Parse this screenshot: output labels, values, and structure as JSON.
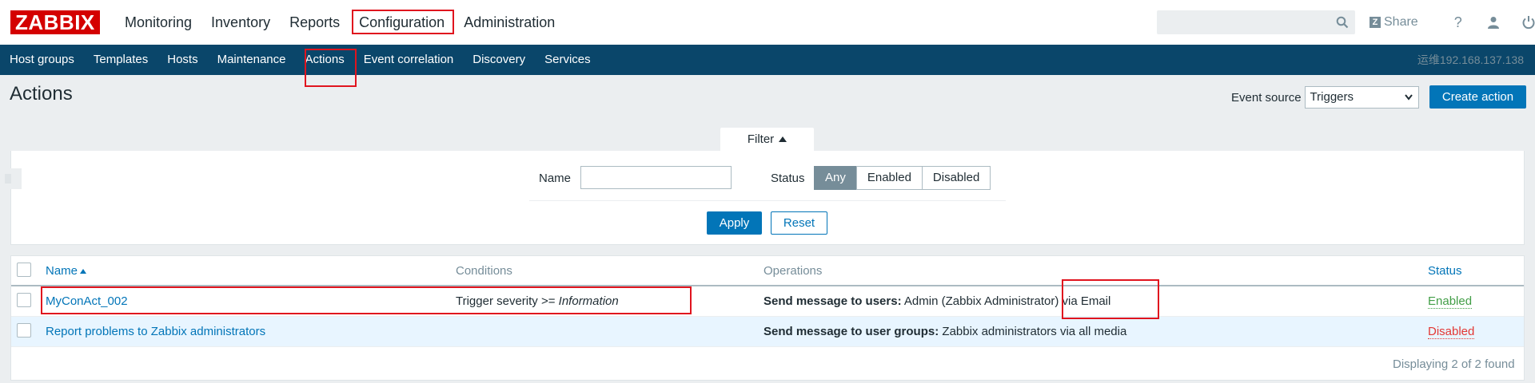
{
  "logo": "ZABBIX",
  "main_menu": [
    {
      "label": "Monitoring"
    },
    {
      "label": "Inventory"
    },
    {
      "label": "Reports"
    },
    {
      "label": "Configuration"
    },
    {
      "label": "Administration"
    }
  ],
  "search": {
    "value": "",
    "placeholder": ""
  },
  "header_tools": {
    "share_label": "Share",
    "help_icon": "help-icon",
    "profile_icon": "user-icon",
    "logout_icon": "power-icon"
  },
  "sub_menu": [
    {
      "label": "Host groups"
    },
    {
      "label": "Templates"
    },
    {
      "label": "Hosts"
    },
    {
      "label": "Maintenance"
    },
    {
      "label": "Actions"
    },
    {
      "label": "Event correlation"
    },
    {
      "label": "Discovery"
    },
    {
      "label": "Services"
    }
  ],
  "server_name": "运维192.168.137.138",
  "page": {
    "title": "Actions",
    "event_source_label": "Event source",
    "event_source_value": "Triggers",
    "create_button": "Create action"
  },
  "filter": {
    "tab_label": "Filter",
    "name_label": "Name",
    "name_value": "",
    "status_label": "Status",
    "status_options": [
      "Any",
      "Enabled",
      "Disabled"
    ],
    "status_selected": "Any",
    "apply_label": "Apply",
    "reset_label": "Reset"
  },
  "table": {
    "columns": {
      "name": "Name",
      "conditions": "Conditions",
      "operations": "Operations",
      "status": "Status"
    },
    "rows": [
      {
        "name": "MyConAct_002",
        "condition_prefix": "Trigger severity >= ",
        "condition_value": "Information",
        "operation_label": "Send message to users:",
        "operation_text": " Admin (Zabbix Administrator) via Email",
        "status": "Enabled"
      },
      {
        "name": "Report problems to Zabbix administrators",
        "condition_prefix": "",
        "condition_value": "",
        "operation_label": "Send message to user groups:",
        "operation_text": " Zabbix administrators via all media",
        "status": "Disabled"
      }
    ],
    "footer": "Displaying 2 of 2 found"
  },
  "colors": {
    "brand": "#d40000",
    "subnav": "#0a466a",
    "primary": "#0275b8",
    "enabled": "#429e47",
    "disabled": "#e33734",
    "highlight": "#e0141e"
  }
}
